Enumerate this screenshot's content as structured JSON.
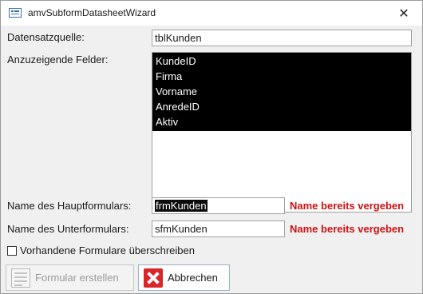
{
  "window": {
    "title": "amvSubformDatasheetWizard",
    "close_glyph": "✕"
  },
  "form": {
    "datasource_label": "Datensatzquelle:",
    "datasource_value": "tblKunden",
    "fields_label": "Anzuzeigende Felder:",
    "fields": [
      "KundeID",
      "Firma",
      "Vorname",
      "AnredeID",
      "Aktiv"
    ],
    "main_form_label": "Name des Hauptformulars:",
    "main_form_value": "frmKunden",
    "main_form_error": "Name bereits vergeben",
    "sub_form_label": "Name des Unterformulars:",
    "sub_form_value": "sfmKunden",
    "sub_form_error": "Name bereits vergeben",
    "overwrite_label": "Vorhandene Formulare überschreiben",
    "overwrite_checked": false
  },
  "buttons": {
    "create_label": "Formular erstellen",
    "cancel_label": "Abbrechen"
  },
  "icons": {
    "title": "form-window-icon",
    "create": "form-icon",
    "cancel": "cancel-x-icon"
  },
  "colors": {
    "error": "#d01010",
    "selection": "#000000",
    "cancel_icon": "#d9262a"
  }
}
